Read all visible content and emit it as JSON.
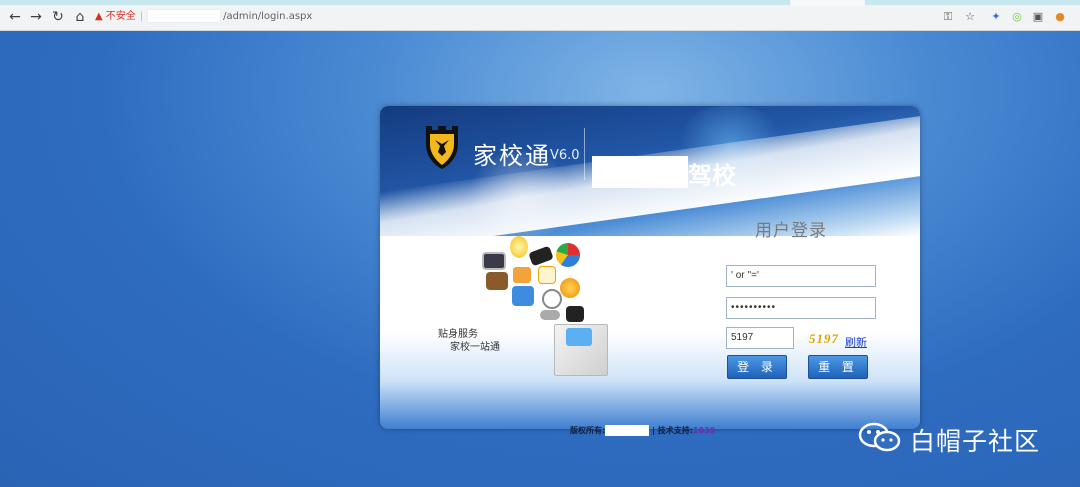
{
  "browser": {
    "back_icon": "arrow-left-icon",
    "forward_icon": "arrow-right-icon",
    "reload_icon": "reload-icon",
    "home_icon": "home-icon",
    "security_warning": "不安全",
    "url_path": "/admin/login.aspx"
  },
  "banner": {
    "brand": "家校通",
    "version": "V6.0",
    "school_suffix": "驾校"
  },
  "login": {
    "title": "用户登录",
    "username_value": "' or ''='",
    "password_value": "••••••••••",
    "code_value": "5197",
    "captcha_text": "5197",
    "refresh_label": "刷新",
    "login_button": "登 录",
    "reset_button": "重 置"
  },
  "slogan": {
    "line1": "贴身服务",
    "line2": "家校一站通"
  },
  "footer": {
    "copyright_label": "版权所有:",
    "support_label": "| 技术支持:",
    "support_value": "1039"
  },
  "watermark": {
    "text": "白帽子社区"
  }
}
